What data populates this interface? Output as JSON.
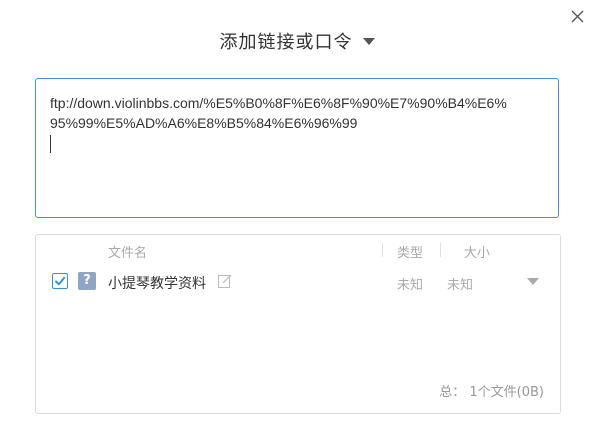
{
  "dialog": {
    "title": "添加链接或口令",
    "close_icon": "close-icon"
  },
  "url_input": {
    "value_line1": "ftp://down.violinbbs.com/%E5%B0%8F%E6%8F%90%E7%90%B4%E6%",
    "value_line2": "95%99%E5%AD%A6%E8%B5%84%E6%96%99"
  },
  "file_table": {
    "headers": {
      "name": "文件名",
      "type": "类型",
      "size": "大小"
    },
    "rows": [
      {
        "checked": true,
        "icon": "unknown-file-icon",
        "icon_glyph": "?",
        "name": "小提琴教学资料",
        "type": "未知",
        "size": "未知"
      }
    ],
    "summary": "总： 1个文件(0B)"
  },
  "colors": {
    "accent": "#3a8ee6",
    "input_border": "#4a8cf0",
    "panel_border": "#dcdcdc",
    "muted_text": "#aaaaaa",
    "file_icon_bg": "#8ea6c4"
  }
}
